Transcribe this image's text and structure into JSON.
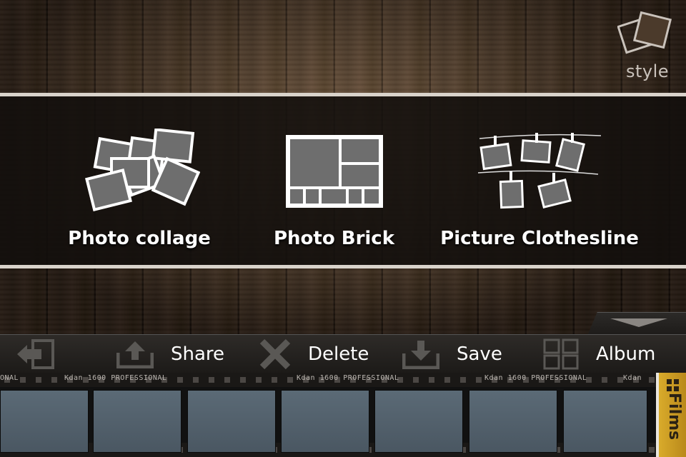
{
  "style_button": {
    "label": "style",
    "icon": "style-stack-icon"
  },
  "options": [
    {
      "title": "Photo collage",
      "icon": "photo-collage-icon"
    },
    {
      "title": "Photo Brick",
      "icon": "photo-brick-icon"
    },
    {
      "title": "Picture Clothesline",
      "icon": "picture-clothesline-icon"
    }
  ],
  "toolbar": {
    "exit_icon": "exit-icon",
    "share": {
      "label": "Share",
      "icon": "share-icon"
    },
    "delete": {
      "label": "Delete",
      "icon": "delete-icon"
    },
    "save": {
      "label": "Save",
      "icon": "save-icon"
    },
    "album": {
      "label": "Album",
      "icon": "album-grid-icon"
    }
  },
  "filmstrip": {
    "edge_codes": [
      "ONAL",
      "Kdan 1600 PROFESSIONAL",
      "Kdan 1600 PROFESSIONAL",
      "Kdan 1600 PROFESSIONAL",
      "Kdan"
    ],
    "films_tab_label": "Films"
  },
  "colors": {
    "band_border": "#d9d3cb",
    "films_tab": "#d9ab2b",
    "frame": "#55636e"
  }
}
